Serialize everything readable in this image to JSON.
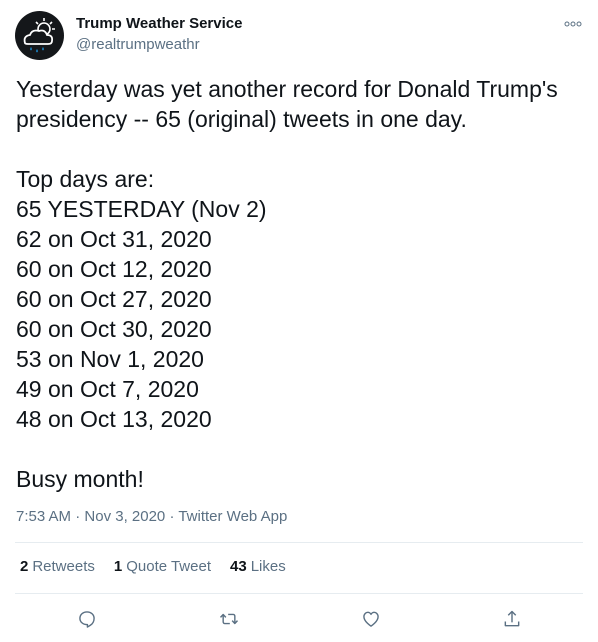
{
  "author": {
    "name": "Trump Weather Service",
    "handle": "@realtrumpweathr",
    "avatar_icon": "storm-cloud-icon"
  },
  "more_icon": "more-options-icon",
  "tweet": {
    "lines": [
      "Yesterday was yet another record for Donald Trump's",
      "presidency -- 65 (original) tweets in one day.",
      "",
      "Top days are:",
      "65 YESTERDAY (Nov 2)",
      "62 on Oct 31, 2020",
      "60 on Oct 12, 2020",
      "60 on Oct 27, 2020",
      "60 on Oct 30, 2020",
      "53 on Nov 1, 2020",
      "49 on Oct 7, 2020",
      "48 on Oct 13, 2020",
      "",
      "Busy month!"
    ]
  },
  "meta": {
    "time": "7:53 AM",
    "separator": " · ",
    "date": "Nov 3, 2020",
    "source": "Twitter Web App"
  },
  "stats": {
    "retweets_count": "2",
    "retweets_label": "Retweets",
    "quotes_count": "1",
    "quotes_label": "Quote Tweet",
    "likes_count": "43",
    "likes_label": "Likes"
  },
  "actions": [
    "reply-icon",
    "retweet-icon",
    "like-icon",
    "share-icon"
  ],
  "colors": {
    "text": "#0f1419",
    "secondary": "#5b7083",
    "divider": "#e6ecf0",
    "icon": "#5b7083"
  }
}
